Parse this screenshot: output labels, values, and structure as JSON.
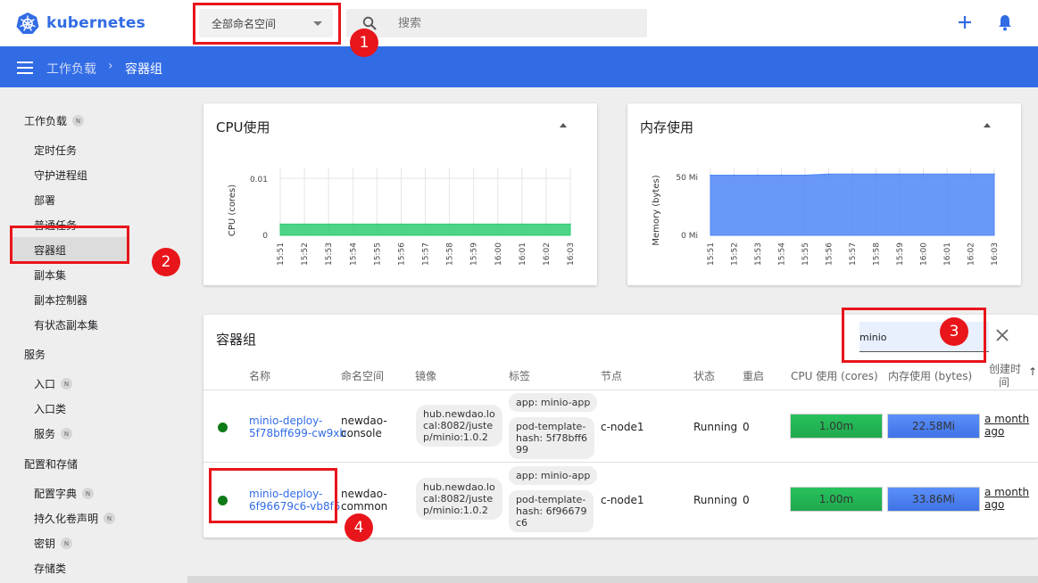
{
  "app": {
    "logo_text": "kubernetes"
  },
  "header": {
    "namespace_selector": "全部命名空间",
    "search_placeholder": "搜索"
  },
  "breadcrumb": {
    "parent": "工作负载",
    "separator": "›",
    "current": "容器组"
  },
  "sidebar": {
    "workloads": {
      "label": "工作负载",
      "badge": "N"
    },
    "workload_items": [
      "定时任务",
      "守护进程组",
      "部署",
      "普通任务",
      "容器组",
      "副本集",
      "副本控制器",
      "有状态副本集"
    ],
    "services": {
      "label": "服务"
    },
    "service_items": [
      {
        "label": "入口",
        "badge": "N"
      },
      {
        "label": "入口类",
        "badge": ""
      },
      {
        "label": "服务",
        "badge": "N"
      }
    ],
    "config": {
      "label": "配置和存储"
    },
    "config_items": [
      {
        "label": "配置字典",
        "badge": "N"
      },
      {
        "label": "持久化卷声明",
        "badge": "N"
      },
      {
        "label": "密钥",
        "badge": "N"
      },
      {
        "label": "存储类",
        "badge": ""
      }
    ]
  },
  "cpu_chart": {
    "title": "CPU使用",
    "chart_data": {
      "type": "area",
      "ylabel": "CPU (cores)",
      "y_ticks": [
        "0.01",
        "0"
      ],
      "x": [
        "15:51",
        "15:52",
        "15:53",
        "15:54",
        "15:55",
        "15:56",
        "15:57",
        "15:58",
        "15:59",
        "16:00",
        "16:01",
        "16:02",
        "16:03"
      ],
      "values": [
        0.002,
        0.002,
        0.002,
        0.002,
        0.002,
        0.002,
        0.002,
        0.002,
        0.002,
        0.002,
        0.002,
        0.002,
        0.002
      ],
      "ylim": [
        0,
        0.012
      ],
      "color": "#2ecc71"
    }
  },
  "mem_chart": {
    "title": "内存使用",
    "chart_data": {
      "type": "area",
      "ylabel": "Memory (bytes)",
      "y_ticks": [
        "50 Mi",
        "0 Mi"
      ],
      "x": [
        "15:51",
        "15:52",
        "15:53",
        "15:54",
        "15:55",
        "15:56",
        "15:57",
        "15:58",
        "15:59",
        "16:00",
        "16:01",
        "16:02",
        "16:03"
      ],
      "values": [
        56,
        56,
        56,
        56,
        56,
        57,
        57,
        57,
        57,
        57,
        57,
        57,
        57
      ],
      "ylim": [
        0,
        63
      ],
      "color": "#4f86f7"
    }
  },
  "pods": {
    "title": "容器组",
    "filter_value": "minio",
    "columns": {
      "name": "名称",
      "namespace": "命名空间",
      "image": "镜像",
      "labels": "标签",
      "node": "节点",
      "status": "状态",
      "restarts": "重启",
      "cpu": "CPU 使用 (cores)",
      "mem": "内存使用 (bytes)",
      "created_1": "创建时",
      "created_2": "间",
      "sort_arrow": "↑"
    },
    "rows": [
      {
        "name_1": "minio-deploy-",
        "name_2": "5f78bff699-cw9xb",
        "ns_1": "newdao-",
        "ns_2": "console",
        "image_1": "hub.newdao.lo",
        "image_2": "cal:8082/juste",
        "image_3": "p/minio:1.0.2",
        "label_app": "app: minio-app",
        "label_hash_1": "pod-template-",
        "label_hash_2": "hash: 5f78bff6",
        "label_hash_3": "99",
        "node": "c-node1",
        "status": "Running",
        "restarts": "0",
        "cpu": "1.00m",
        "mem": "22.58Mi",
        "age_1": "a month",
        "age_2": "ago",
        "status_color": "#0f7a18"
      },
      {
        "name_1": "minio-deploy-",
        "name_2": "6f96679c6-vb8f5",
        "ns_1": "newdao-",
        "ns_2": "common",
        "image_1": "hub.newdao.lo",
        "image_2": "cal:8082/juste",
        "image_3": "p/minio:1.0.2",
        "label_app": "app: minio-app",
        "label_hash_1": "pod-template-",
        "label_hash_2": "hash: 6f96679",
        "label_hash_3": "c6",
        "node": "c-node1",
        "status": "Running",
        "restarts": "0",
        "cpu": "1.00m",
        "mem": "33.86Mi",
        "age_1": "a month",
        "age_2": "ago",
        "status_color": "#0f7a18"
      }
    ]
  },
  "annotations": {
    "m1": "1",
    "m2": "2",
    "m3": "3",
    "m4": "4"
  },
  "colors": {
    "brand": "#326ce5",
    "annotation": "#e8151a",
    "cpu_bar": "#27c25c",
    "mem_bar": "#4f86f7"
  }
}
